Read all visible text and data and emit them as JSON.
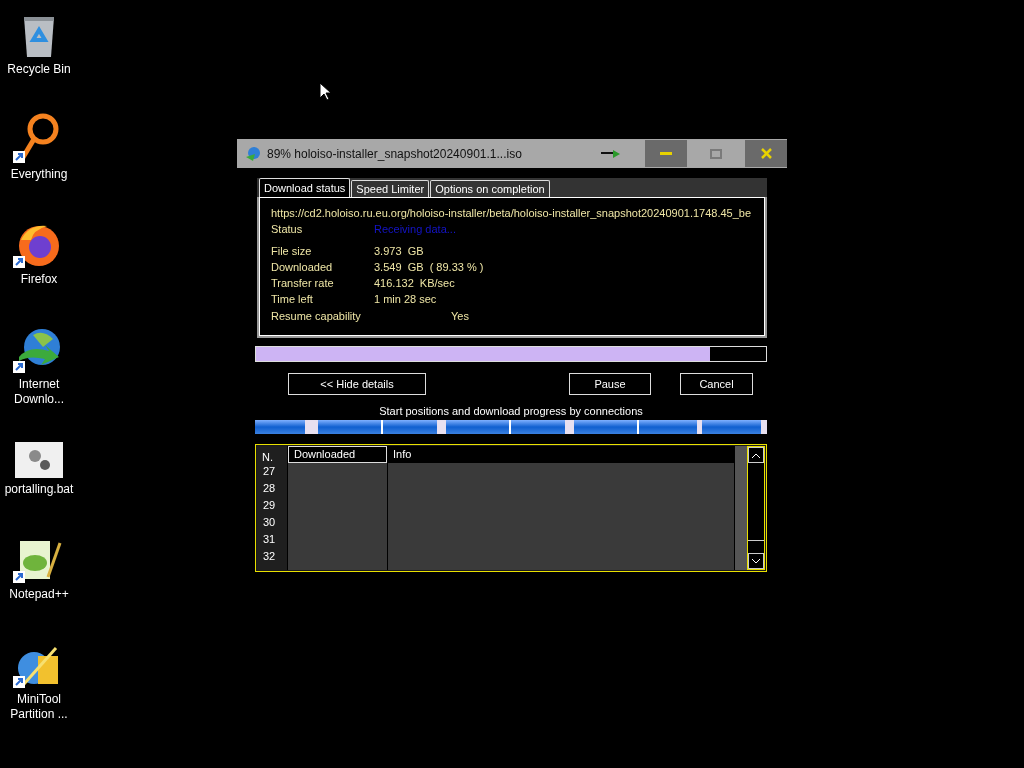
{
  "desktop_icons": [
    {
      "label": "Recycle Bin",
      "kind": "recycle",
      "shortcut": false
    },
    {
      "label": "Everything",
      "kind": "ring",
      "shortcut": true
    },
    {
      "label": "Firefox",
      "kind": "globe",
      "shortcut": true
    },
    {
      "label": "Internet Downlo...",
      "kind": "download",
      "shortcut": true
    },
    {
      "label": "portalling.bat",
      "kind": "gears",
      "shortcut": false
    },
    {
      "label": "Notepad++",
      "kind": "notepad",
      "shortcut": true
    },
    {
      "label": "MiniTool Partition ...",
      "kind": "wand",
      "shortcut": true
    }
  ],
  "window": {
    "title": "89% holoiso-installer_snapshot20240901.1...iso",
    "controls": [
      {
        "kind": "minimize",
        "disabled": false
      },
      {
        "kind": "maximize",
        "disabled": true
      },
      {
        "kind": "close",
        "disabled": false
      }
    ],
    "tabs": [
      {
        "label": "Download status",
        "selected": true
      },
      {
        "label": "Speed Limiter",
        "selected": false
      },
      {
        "label": "Options on completion",
        "selected": false
      }
    ],
    "url": "https://cd2.holoiso.ru.eu.org/holoiso-installer/beta/holoiso-installer_snapshot20240901.1748.45_be",
    "status": {
      "label": "Status",
      "value": "Receiving data..."
    },
    "details": [
      {
        "label": "File size",
        "value": "3.973  GB"
      },
      {
        "label": "Downloaded",
        "value": "3.549  GB  ( 89.33 % )"
      },
      {
        "label": "Transfer rate",
        "value": "416.132  KB/sec"
      },
      {
        "label": "Time left",
        "value": "1 min 28 sec"
      }
    ],
    "resume": {
      "label": "Resume capability",
      "value": "Yes"
    },
    "progress": {
      "level": 0.89
    },
    "buttons": [
      {
        "label": "<< Hide details"
      },
      {
        "label": "Pause"
      },
      {
        "label": "Cancel"
      }
    ],
    "connections_caption": "Start positions and download progress by connections",
    "table": {
      "columns": [
        "N.",
        "Downloaded",
        "Info"
      ],
      "rows": [
        {
          "n": "27"
        },
        {
          "n": "28"
        },
        {
          "n": "29"
        },
        {
          "n": "30"
        },
        {
          "n": "31"
        },
        {
          "n": "32"
        }
      ]
    }
  }
}
